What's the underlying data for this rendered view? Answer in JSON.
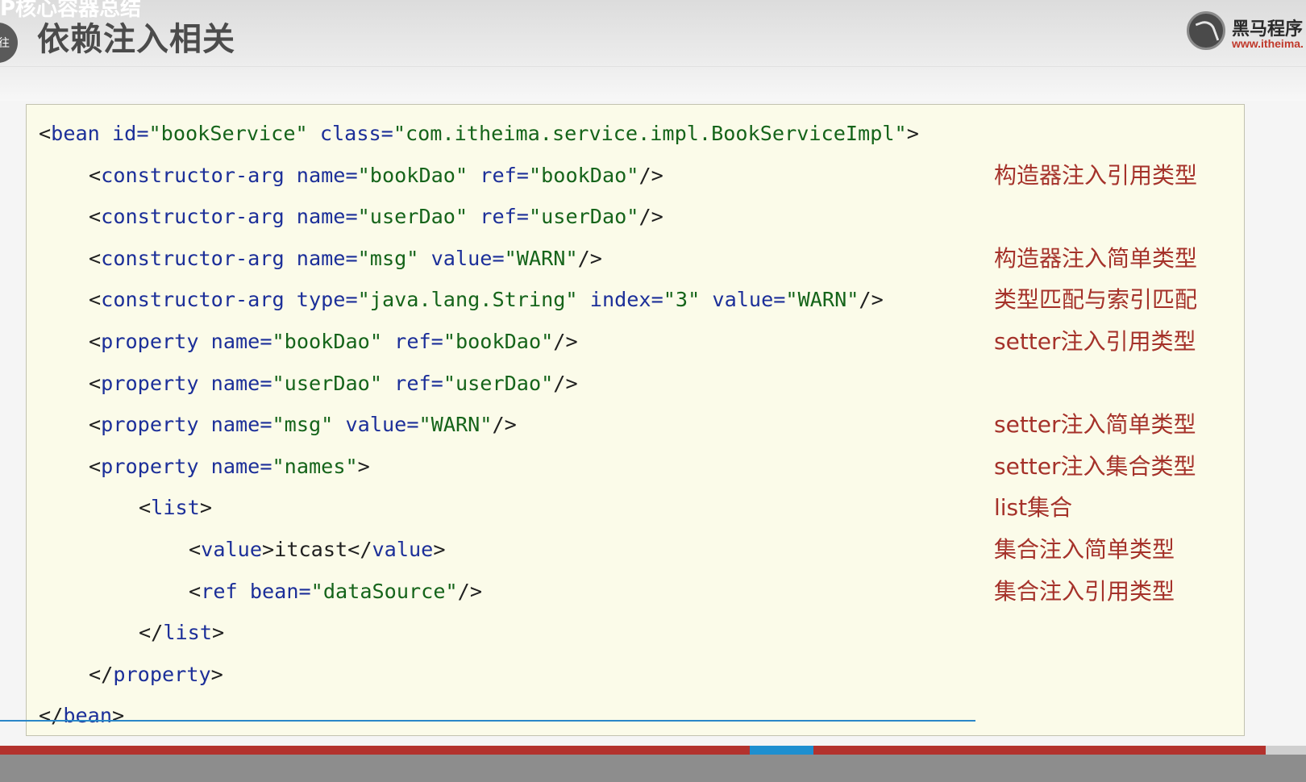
{
  "slide": {
    "top_clip_text": "P核心容器总结",
    "left_nav_glyph": "往",
    "title": "依赖注入相关",
    "logo": {
      "name": "黑马程序",
      "url": "www.itheima."
    }
  },
  "code": {
    "lines": [
      {
        "indent": 0,
        "tokens": [
          {
            "c": "punct",
            "t": "<"
          },
          {
            "c": "tag",
            "t": "bean"
          },
          {
            "c": "attr",
            "t": " id="
          },
          {
            "c": "str",
            "t": "\"bookService\""
          },
          {
            "c": "attr",
            "t": " class="
          },
          {
            "c": "str",
            "t": "\"com.itheima.service.impl.BookServiceImpl\""
          },
          {
            "c": "punct",
            "t": ">"
          }
        ]
      },
      {
        "indent": 1,
        "tokens": [
          {
            "c": "punct",
            "t": "<"
          },
          {
            "c": "tag",
            "t": "constructor-arg"
          },
          {
            "c": "attr",
            "t": " name="
          },
          {
            "c": "str",
            "t": "\"bookDao\""
          },
          {
            "c": "attr",
            "t": " ref="
          },
          {
            "c": "str",
            "t": "\"bookDao\""
          },
          {
            "c": "punct",
            "t": "/>"
          }
        ]
      },
      {
        "indent": 1,
        "tokens": [
          {
            "c": "punct",
            "t": "<"
          },
          {
            "c": "tag",
            "t": "constructor-arg"
          },
          {
            "c": "attr",
            "t": " name="
          },
          {
            "c": "str",
            "t": "\"userDao\""
          },
          {
            "c": "attr",
            "t": " ref="
          },
          {
            "c": "str",
            "t": "\"userDao\""
          },
          {
            "c": "punct",
            "t": "/>"
          }
        ]
      },
      {
        "indent": 1,
        "tokens": [
          {
            "c": "punct",
            "t": "<"
          },
          {
            "c": "tag",
            "t": "constructor-arg"
          },
          {
            "c": "attr",
            "t": " name="
          },
          {
            "c": "str",
            "t": "\"msg\""
          },
          {
            "c": "attr",
            "t": " value="
          },
          {
            "c": "str",
            "t": "\"WARN\""
          },
          {
            "c": "punct",
            "t": "/>"
          }
        ]
      },
      {
        "indent": 1,
        "tokens": [
          {
            "c": "punct",
            "t": "<"
          },
          {
            "c": "tag",
            "t": "constructor-arg"
          },
          {
            "c": "attr",
            "t": " type="
          },
          {
            "c": "str",
            "t": "\"java.lang.String\""
          },
          {
            "c": "attr",
            "t": " index="
          },
          {
            "c": "str",
            "t": "\"3\""
          },
          {
            "c": "attr",
            "t": " value="
          },
          {
            "c": "str",
            "t": "\"WARN\""
          },
          {
            "c": "punct",
            "t": "/>"
          }
        ]
      },
      {
        "indent": 1,
        "tokens": [
          {
            "c": "punct",
            "t": "<"
          },
          {
            "c": "tag",
            "t": "property"
          },
          {
            "c": "attr",
            "t": " name="
          },
          {
            "c": "str",
            "t": "\"bookDao\""
          },
          {
            "c": "attr",
            "t": " ref="
          },
          {
            "c": "str",
            "t": "\"bookDao\""
          },
          {
            "c": "punct",
            "t": "/>"
          }
        ]
      },
      {
        "indent": 1,
        "tokens": [
          {
            "c": "punct",
            "t": "<"
          },
          {
            "c": "tag",
            "t": "property"
          },
          {
            "c": "attr",
            "t": " name="
          },
          {
            "c": "str",
            "t": "\"userDao\""
          },
          {
            "c": "attr",
            "t": " ref="
          },
          {
            "c": "str",
            "t": "\"userDao\""
          },
          {
            "c": "punct",
            "t": "/>"
          }
        ]
      },
      {
        "indent": 1,
        "tokens": [
          {
            "c": "punct",
            "t": "<"
          },
          {
            "c": "tag",
            "t": "property"
          },
          {
            "c": "attr",
            "t": " name="
          },
          {
            "c": "str",
            "t": "\"msg\""
          },
          {
            "c": "attr",
            "t": " value="
          },
          {
            "c": "str",
            "t": "\"WARN\""
          },
          {
            "c": "punct",
            "t": "/>"
          }
        ]
      },
      {
        "indent": 1,
        "tokens": [
          {
            "c": "punct",
            "t": "<"
          },
          {
            "c": "tag",
            "t": "property"
          },
          {
            "c": "attr",
            "t": " name="
          },
          {
            "c": "str",
            "t": "\"names\""
          },
          {
            "c": "punct",
            "t": ">"
          }
        ]
      },
      {
        "indent": 2,
        "tokens": [
          {
            "c": "punct",
            "t": "<"
          },
          {
            "c": "tag",
            "t": "list"
          },
          {
            "c": "punct",
            "t": ">"
          }
        ]
      },
      {
        "indent": 3,
        "tokens": [
          {
            "c": "punct",
            "t": "<"
          },
          {
            "c": "tag",
            "t": "value"
          },
          {
            "c": "punct",
            "t": ">"
          },
          {
            "c": "text",
            "t": "itcast"
          },
          {
            "c": "punct",
            "t": "</"
          },
          {
            "c": "tag",
            "t": "value"
          },
          {
            "c": "punct",
            "t": ">"
          }
        ]
      },
      {
        "indent": 3,
        "tokens": [
          {
            "c": "punct",
            "t": "<"
          },
          {
            "c": "tag",
            "t": "ref"
          },
          {
            "c": "attr",
            "t": " bean="
          },
          {
            "c": "str",
            "t": "\"dataSource\""
          },
          {
            "c": "punct",
            "t": "/>"
          }
        ]
      },
      {
        "indent": 2,
        "tokens": [
          {
            "c": "punct",
            "t": "</"
          },
          {
            "c": "tag",
            "t": "list"
          },
          {
            "c": "punct",
            "t": ">"
          }
        ]
      },
      {
        "indent": 1,
        "tokens": [
          {
            "c": "punct",
            "t": "</"
          },
          {
            "c": "tag",
            "t": "property"
          },
          {
            "c": "punct",
            "t": ">"
          }
        ]
      },
      {
        "indent": 0,
        "tokens": [
          {
            "c": "punct",
            "t": "</"
          },
          {
            "c": "tag",
            "t": "bean"
          },
          {
            "c": "punct",
            "t": ">"
          }
        ]
      }
    ],
    "annotations": [
      {
        "line": 1,
        "text": "构造器注入引用类型"
      },
      {
        "line": 3,
        "text": "构造器注入简单类型"
      },
      {
        "line": 4,
        "text": "类型匹配与索引匹配"
      },
      {
        "line": 5,
        "text": "setter注入引用类型"
      },
      {
        "line": 7,
        "text": "setter注入简单类型"
      },
      {
        "line": 8,
        "text": "setter注入集合类型"
      },
      {
        "line": 9,
        "text": "list集合"
      },
      {
        "line": 10,
        "text": "集合注入简单类型"
      },
      {
        "line": 11,
        "text": "集合注入引用类型"
      }
    ]
  },
  "player": {
    "progress_played": 0.574,
    "progress_buffered": 0.049
  }
}
